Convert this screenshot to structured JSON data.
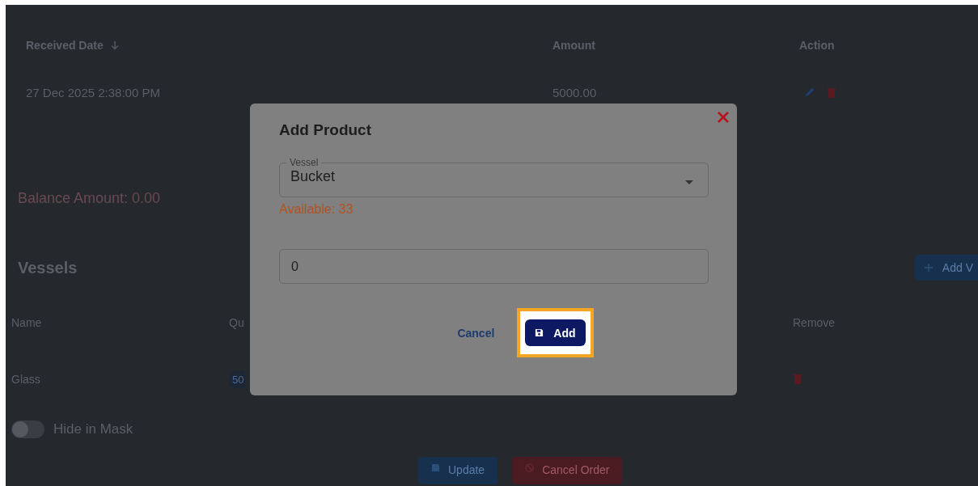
{
  "payments_table": {
    "columns": [
      {
        "label": "Received Date",
        "sorted": true
      },
      {
        "label": "Amount",
        "sorted": false
      },
      {
        "label": "Action",
        "sorted": false
      }
    ],
    "rows": [
      {
        "received_date": "27 Dec 2025 2:38:00 PM",
        "amount": "5000.00",
        "actions": [
          {
            "kind": "edit"
          },
          {
            "kind": "delete"
          }
        ]
      }
    ]
  },
  "balance": "Balance Amount: 0.00",
  "vessels": {
    "title": "Vessels",
    "add_button": "Add V",
    "columns": [
      "Name",
      "Qu",
      "Remove"
    ],
    "rows": [
      {
        "name": "Glass",
        "quantity": "50"
      }
    ]
  },
  "hide_in_mask": {
    "label": "Hide in Mask",
    "on": false
  },
  "footer_buttons": [
    {
      "label": "Update",
      "kind": "primary"
    },
    {
      "label": "Cancel Order",
      "kind": "danger"
    }
  ],
  "dialog": {
    "title": "Add Product",
    "vessel_select": {
      "label": "Vessel",
      "value": "Bucket"
    },
    "available": "Available: 33",
    "quantity_input": {
      "value": "0"
    },
    "buttons": [
      {
        "label": "Cancel",
        "kind": "text",
        "highlighted": false
      },
      {
        "label": "Add",
        "kind": "primary",
        "highlighted": true
      }
    ]
  }
}
